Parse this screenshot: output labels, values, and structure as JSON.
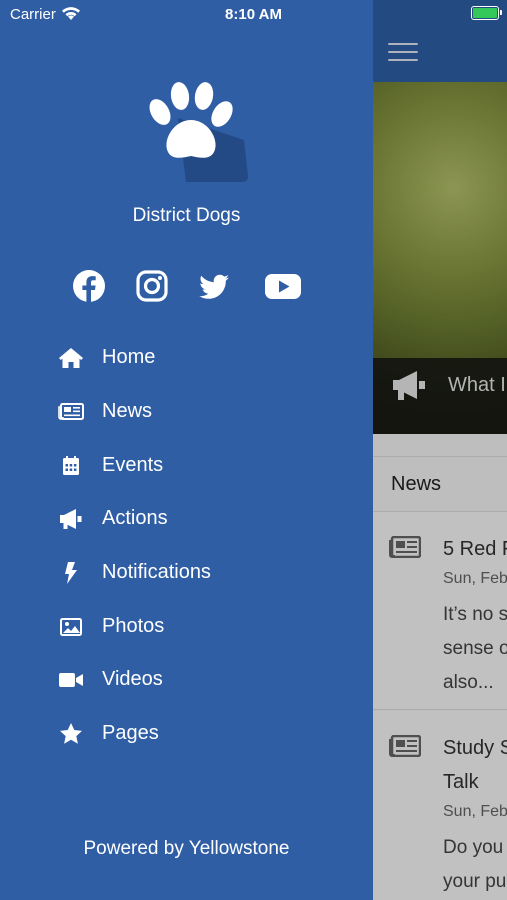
{
  "status_bar": {
    "carrier": "Carrier",
    "time": "8:10 AM"
  },
  "drawer": {
    "app_name": "District Dogs",
    "social": [
      "facebook-icon",
      "instagram-icon",
      "twitter-icon",
      "youtube-icon"
    ],
    "menu": [
      {
        "label": "Home",
        "icon": "home-icon"
      },
      {
        "label": "News",
        "icon": "newspaper-icon"
      },
      {
        "label": "Events",
        "icon": "calendar-icon"
      },
      {
        "label": "Actions",
        "icon": "megaphone-icon"
      },
      {
        "label": "Notifications",
        "icon": "bolt-icon"
      },
      {
        "label": "Photos",
        "icon": "image-icon"
      },
      {
        "label": "Videos",
        "icon": "video-icon"
      },
      {
        "label": "Pages",
        "icon": "star-icon"
      }
    ],
    "footer": "Powered by Yellowstone"
  },
  "background_screen": {
    "hero_text": "What I",
    "news_header": "News",
    "news_items": [
      {
        "title_line1": "5 Red F",
        "date": "Sun, Feb",
        "lines": [
          "It’s no s",
          "sense o",
          "also..."
        ]
      },
      {
        "title_line1": "Study S",
        "title_line2": "Talk",
        "date": "Sun, Feb",
        "lines": [
          "Do you",
          "your pu"
        ]
      }
    ]
  },
  "colors": {
    "drawer": "#2f5ea5",
    "accent_battery": "#34c759"
  }
}
